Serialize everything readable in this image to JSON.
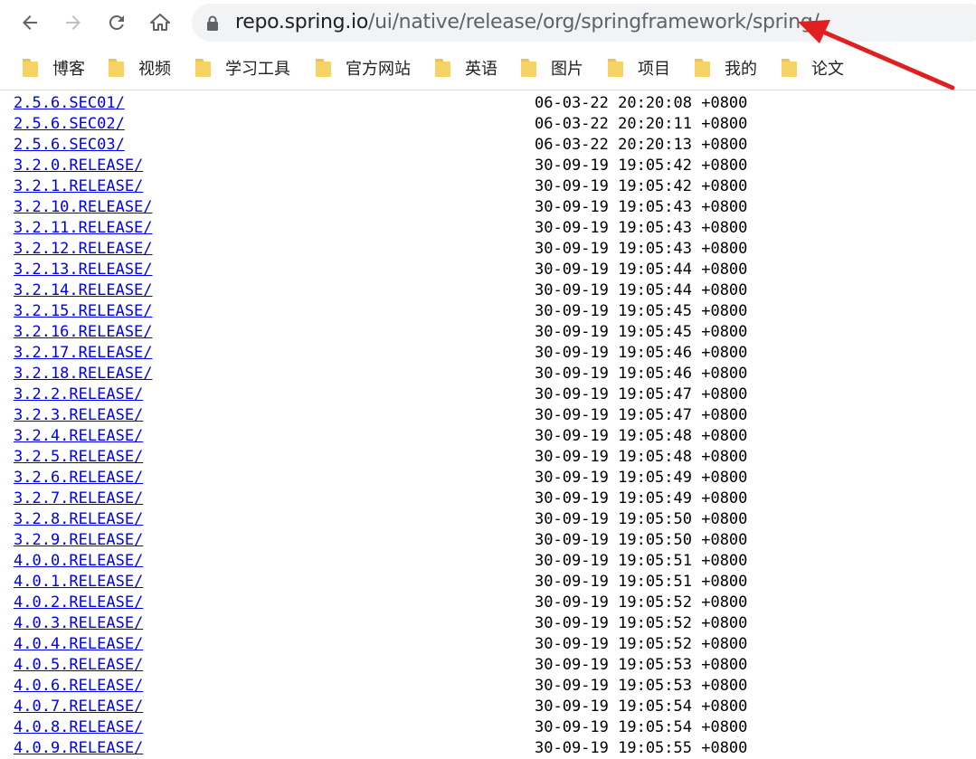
{
  "toolbar": {
    "url_host": "repo.spring.io",
    "url_path": "/ui/native/release/org/springframework/spring/"
  },
  "bookmarks": [
    {
      "label": "博客"
    },
    {
      "label": "视频"
    },
    {
      "label": "学习工具"
    },
    {
      "label": "官方网站"
    },
    {
      "label": "英语"
    },
    {
      "label": "图片"
    },
    {
      "label": "项目"
    },
    {
      "label": "我的"
    },
    {
      "label": "论文"
    }
  ],
  "listing": [
    {
      "name": "2.5.6.SEC01/",
      "date": "06-03-22 20:20:08 +0800"
    },
    {
      "name": "2.5.6.SEC02/",
      "date": "06-03-22 20:20:11 +0800"
    },
    {
      "name": "2.5.6.SEC03/",
      "date": "06-03-22 20:20:13 +0800"
    },
    {
      "name": "3.2.0.RELEASE/",
      "date": "30-09-19 19:05:42 +0800"
    },
    {
      "name": "3.2.1.RELEASE/",
      "date": "30-09-19 19:05:42 +0800"
    },
    {
      "name": "3.2.10.RELEASE/",
      "date": "30-09-19 19:05:43 +0800"
    },
    {
      "name": "3.2.11.RELEASE/",
      "date": "30-09-19 19:05:43 +0800"
    },
    {
      "name": "3.2.12.RELEASE/",
      "date": "30-09-19 19:05:43 +0800"
    },
    {
      "name": "3.2.13.RELEASE/",
      "date": "30-09-19 19:05:44 +0800"
    },
    {
      "name": "3.2.14.RELEASE/",
      "date": "30-09-19 19:05:44 +0800"
    },
    {
      "name": "3.2.15.RELEASE/",
      "date": "30-09-19 19:05:45 +0800"
    },
    {
      "name": "3.2.16.RELEASE/",
      "date": "30-09-19 19:05:45 +0800"
    },
    {
      "name": "3.2.17.RELEASE/",
      "date": "30-09-19 19:05:46 +0800"
    },
    {
      "name": "3.2.18.RELEASE/",
      "date": "30-09-19 19:05:46 +0800"
    },
    {
      "name": "3.2.2.RELEASE/",
      "date": "30-09-19 19:05:47 +0800"
    },
    {
      "name": "3.2.3.RELEASE/",
      "date": "30-09-19 19:05:47 +0800"
    },
    {
      "name": "3.2.4.RELEASE/",
      "date": "30-09-19 19:05:48 +0800"
    },
    {
      "name": "3.2.5.RELEASE/",
      "date": "30-09-19 19:05:48 +0800"
    },
    {
      "name": "3.2.6.RELEASE/",
      "date": "30-09-19 19:05:49 +0800"
    },
    {
      "name": "3.2.7.RELEASE/",
      "date": "30-09-19 19:05:49 +0800"
    },
    {
      "name": "3.2.8.RELEASE/",
      "date": "30-09-19 19:05:50 +0800"
    },
    {
      "name": "3.2.9.RELEASE/",
      "date": "30-09-19 19:05:50 +0800"
    },
    {
      "name": "4.0.0.RELEASE/",
      "date": "30-09-19 19:05:51 +0800"
    },
    {
      "name": "4.0.1.RELEASE/",
      "date": "30-09-19 19:05:51 +0800"
    },
    {
      "name": "4.0.2.RELEASE/",
      "date": "30-09-19 19:05:52 +0800"
    },
    {
      "name": "4.0.3.RELEASE/",
      "date": "30-09-19 19:05:52 +0800"
    },
    {
      "name": "4.0.4.RELEASE/",
      "date": "30-09-19 19:05:52 +0800"
    },
    {
      "name": "4.0.5.RELEASE/",
      "date": "30-09-19 19:05:53 +0800"
    },
    {
      "name": "4.0.6.RELEASE/",
      "date": "30-09-19 19:05:53 +0800"
    },
    {
      "name": "4.0.7.RELEASE/",
      "date": "30-09-19 19:05:54 +0800"
    },
    {
      "name": "4.0.8.RELEASE/",
      "date": "30-09-19 19:05:54 +0800"
    },
    {
      "name": "4.0.9.RELEASE/",
      "date": "30-09-19 19:05:55 +0800"
    }
  ],
  "colors": {
    "link": "#0000ee",
    "annotation_arrow": "#e02020",
    "folder": "#f6d365",
    "omnibox": "#f1f3f4"
  }
}
